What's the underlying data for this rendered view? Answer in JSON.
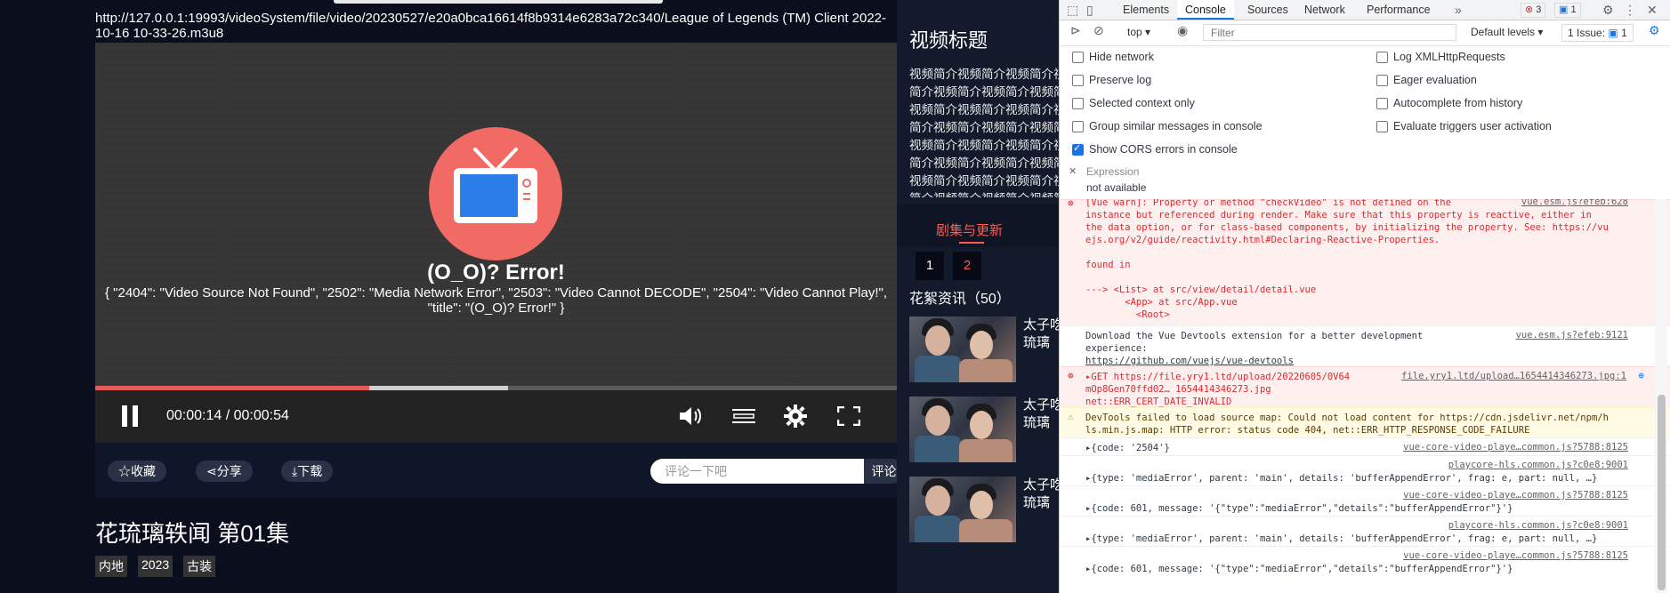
{
  "player": {
    "url": "http://127.0.0.1:19993/videoSystem/file/video/20230527/e20a0bca16614f8b9314e6283a72c340/League of Legends (TM) Client 2022-10-16 10-33-26.m3u8",
    "error_title": "(O_O)?  Error!",
    "error_message": "{ \"2404\": \"Video Source Not Found\", \"2502\": \"Media Network Error\", \"2503\": \"Video Cannot DECODE\", \"2504\": \"Video Cannot Play!\", \"title\": \"(O_O)?  Error!\" }",
    "current_time": "00:00:14",
    "duration": "00:00:54",
    "time_display": "00:00:14 / 00:00:54",
    "played_fraction": 0.342,
    "buffered_fraction": 0.515
  },
  "actions": {
    "favorite": "☆收藏",
    "share": "⋖分享",
    "download": "⤓下载",
    "comment_placeholder": "评论一下吧",
    "comment_button": "评论"
  },
  "video": {
    "title": "花琉璃轶闻 第01集",
    "tags": [
      "内地",
      "2023",
      "古装"
    ]
  },
  "sidebar": {
    "title": "视频标题",
    "description": "视频简介视频简介视频简介视频简介视频简介视频简介视频简介视频简介视频简介视频简介视频简介视频简介视频简介视频简介视频简介视频简介视频简介视频简介视频简介视频简介视频简介视频简介视频简介视频简介视频简介视频简介视频简介视频简介视频简介视频简介视频简介视频简介视频简介视频简介",
    "episodes_tab": "剧集与更新",
    "episodes": [
      "1",
      "2"
    ],
    "news_title": "花絮资讯（50）",
    "news": [
      {
        "text": "太子吃给琉璃"
      },
      {
        "text": "太子吃给琉璃"
      },
      {
        "text": "太子吃给琉璃"
      }
    ]
  },
  "devtools": {
    "tabs": [
      "Elements",
      "Console",
      "Sources",
      "Network",
      "Performance"
    ],
    "error_count": "3",
    "info_count": "1",
    "context": "top",
    "filter_placeholder": "Filter",
    "levels": "Default levels",
    "issues": "1 Issue:",
    "issues_count": "1",
    "settings_left": [
      {
        "label": "Hide network",
        "checked": false
      },
      {
        "label": "Preserve log",
        "checked": false
      },
      {
        "label": "Selected context only",
        "checked": false
      },
      {
        "label": "Group similar messages in console",
        "checked": false
      },
      {
        "label": "Show CORS errors in console",
        "checked": true
      }
    ],
    "settings_right": [
      {
        "label": "Log XMLHttpRequests",
        "checked": false
      },
      {
        "label": "Eager evaluation",
        "checked": false
      },
      {
        "label": "Autocomplete from history",
        "checked": false
      },
      {
        "label": "Evaluate triggers user activation",
        "checked": false
      }
    ],
    "expression_label": "Expression",
    "expression_value": "not available",
    "messages": {
      "vue_warn_1": "[Vue warn]: Property or method \"checkVideo\" is not defined on the",
      "vue_warn_1_src": "vue.esm.js?efeb:628",
      "vue_warn_2": "instance but referenced during render. Make sure that this property is reactive, either in",
      "vue_warn_3": "the data option, or for class-based components, by initializing the property. See: https://vu",
      "vue_warn_4": "ejs.org/v2/guide/reactivity.html#Declaring-Reactive-Properties.",
      "vue_warn_5": "found in",
      "vue_warn_6": "---> <List> at src/view/detail/detail.vue",
      "vue_warn_7": "       <App> at src/App.vue",
      "vue_warn_8": "         <Root>",
      "devtools_1": "Download the Vue Devtools extension for a better development",
      "devtools_src": "vue.esm.js?efeb:9121",
      "devtools_2": "experience:",
      "devtools_3": "https://github.com/vuejs/vue-devtools",
      "get_1": "▸GET https://file.yry1.ltd/upload/20220605/0V64",
      "get_src": "file.yry1.ltd/upload…1654414346273.jpg:1",
      "get_2": "mOp8Gen70ffd02… 1654414346273.jpg",
      "get_3": "net::ERR_CERT_DATE_INVALID",
      "warn_1": "DevTools failed to load source map: Could not load content for https://cdn.jsdelivr.net/npm/h",
      "warn_2": "ls.min.js.map: HTTP error: status code 404, net::ERR_HTTP_RESPONSE_CODE_FAILURE",
      "log_1": "▸{code: '2504'}",
      "log_1_src": "vue-core-video-playe…common.js?5788:8125",
      "log_2_src": "playcore-hls.common.js?c0e8:9001",
      "log_2": "▸{type: 'mediaError', parent: 'main', details: 'bufferAppendError', frag: e, part: null, …}",
      "log_3_src": "vue-core-video-playe…common.js?5788:8125",
      "log_3": "▸{code: 601, message: '{\"type\":\"mediaError\",\"details\":\"bufferAppendError\"}'}",
      "log_4_src": "playcore-hls.common.js?c0e8:9001",
      "log_4": "▸{type: 'mediaError', parent: 'main', details: 'bufferAppendError', frag: e, part: null, …}",
      "log_5_src": "vue-core-video-playe…common.js?5788:8125",
      "log_5": "▸{code: 601, message: '{\"type\":\"mediaError\",\"details\":\"bufferAppendError\"}'}"
    }
  }
}
